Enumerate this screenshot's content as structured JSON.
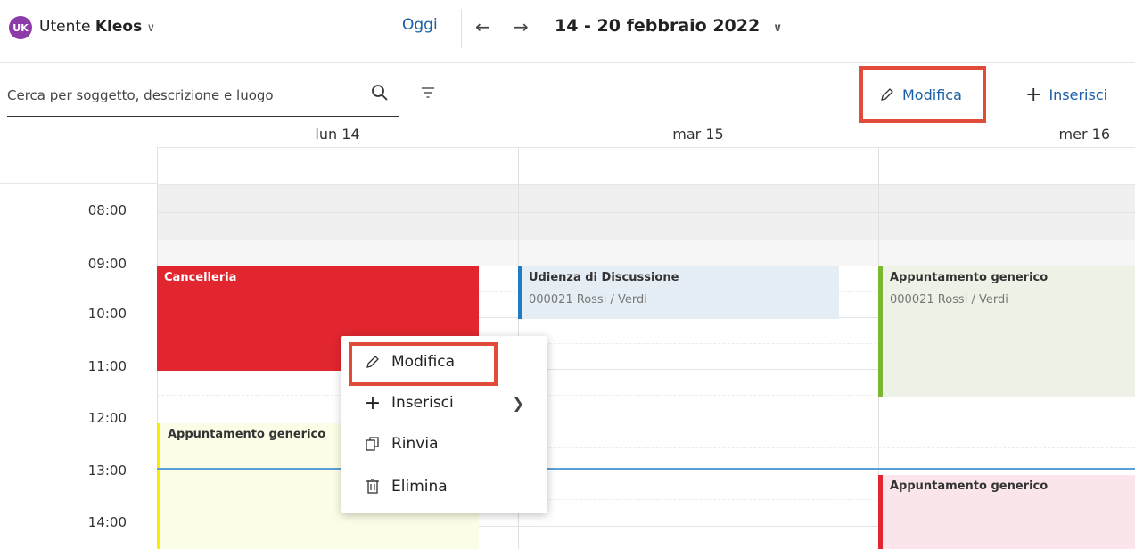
{
  "header": {
    "avatar_initials": "UK",
    "user_prefix": "Utente",
    "user_name": "Kleos",
    "today_label": "Oggi",
    "week_range": "14 - 20 febbraio 2022"
  },
  "search": {
    "placeholder": "Cerca per soggetto, descrizione e luogo"
  },
  "toolbar": {
    "edit_label": "Modifica",
    "insert_label": "Inserisci"
  },
  "days": [
    "lun 14",
    "mar 15",
    "mer 16"
  ],
  "hours": [
    "08:00",
    "09:00",
    "10:00",
    "11:00",
    "12:00",
    "13:00",
    "14:00"
  ],
  "events": {
    "cancelleria": {
      "title": "Cancelleria"
    },
    "udienza": {
      "title": "Udienza di Discussione",
      "subtitle": "000021 Rossi / Verdi"
    },
    "appuntamento_mer": {
      "title": "Appuntamento generico",
      "subtitle": "000021 Rossi / Verdi"
    },
    "appuntamento_lun": {
      "title": "Appuntamento generico"
    },
    "appuntamento_mer2": {
      "title": "Appuntamento generico"
    }
  },
  "context_menu": {
    "items": [
      {
        "label": "Modifica",
        "icon": "pencil-icon"
      },
      {
        "label": "Inserisci",
        "icon": "plus-icon"
      },
      {
        "label": "Rinvia",
        "icon": "copy-icon"
      },
      {
        "label": "Elimina",
        "icon": "trash-icon"
      }
    ]
  },
  "colors": {
    "accent": "#1a5fa6",
    "highlight": "#e04b3a",
    "cancelleria": "#e1262f",
    "udienza_bg": "#e6eef5",
    "udienza_bar": "#1f7cc4",
    "green_bg": "#eef2e6",
    "green_bar": "#7cb82f",
    "yellow_bg": "#fcfde6",
    "yellow_bar": "#f5f000",
    "pink_bg": "#fae6ea",
    "pink_bar": "#e1262f"
  }
}
